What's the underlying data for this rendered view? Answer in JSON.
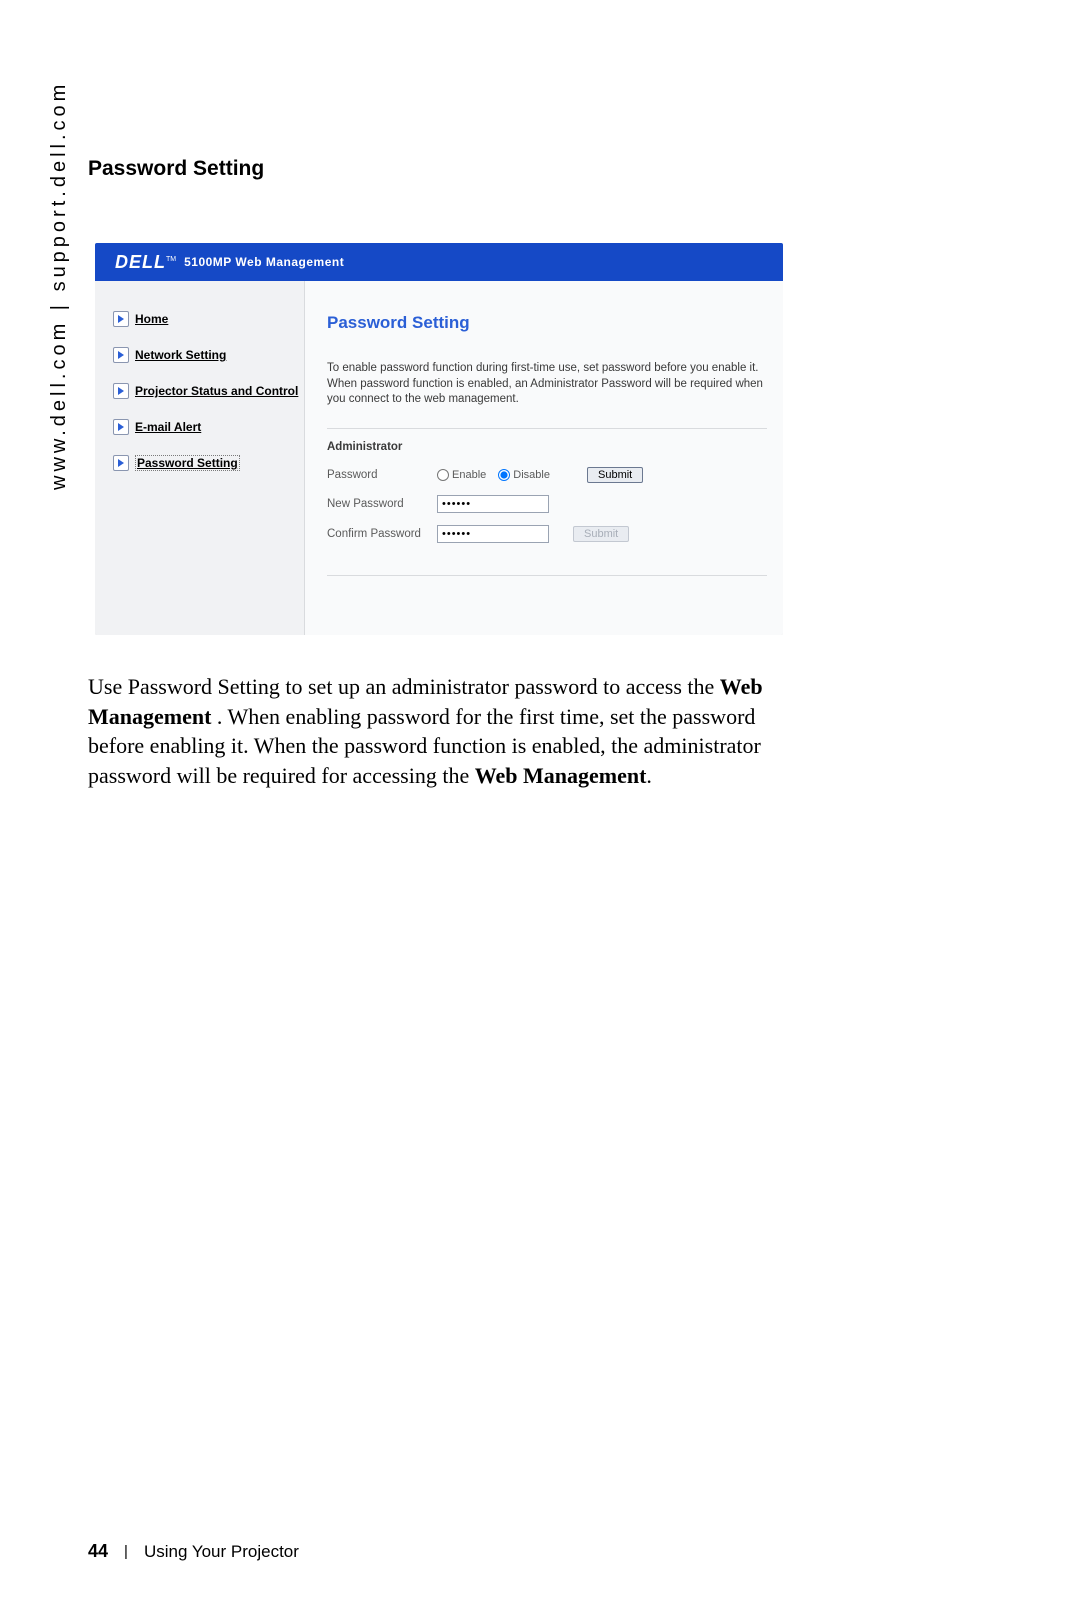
{
  "side_url": "www.dell.com | support.dell.com",
  "page_heading": "Password Setting",
  "app": {
    "logo_text": "DELL",
    "logo_tm": "TM",
    "header_title": "5100MP Web Management",
    "nav": [
      {
        "label": "Home"
      },
      {
        "label": "Network Setting"
      },
      {
        "label": "Projector Status and Control"
      },
      {
        "label": "E-mail Alert"
      },
      {
        "label": "Password Setting"
      }
    ],
    "content": {
      "title": "Password Setting",
      "intro": "To enable password function during first-time use, set password before you enable it. When password function is enabled, an Administrator Password will be required when you connect to the web management.",
      "section_label": "Administrator",
      "rows": {
        "password_label": "Password",
        "enable_label": "Enable",
        "disable_label": "Disable",
        "submit1_label": "Submit",
        "new_pw_label": "New Password",
        "confirm_pw_label": "Confirm Password",
        "submit2_label": "Submit",
        "new_pw_value": "******",
        "confirm_pw_value": "******"
      }
    }
  },
  "body_paragraph": {
    "part1": "Use Password Setting to set up an administrator password to access the ",
    "bold1": "Web Management",
    "part2": " .  When enabling password for the first time, set the password before enabling it. When the password function is enabled, the administrator password will be required for accessing the ",
    "bold2": "Web Management",
    "part3": "."
  },
  "footer": {
    "page_number": "44",
    "section": "Using Your Projector"
  }
}
